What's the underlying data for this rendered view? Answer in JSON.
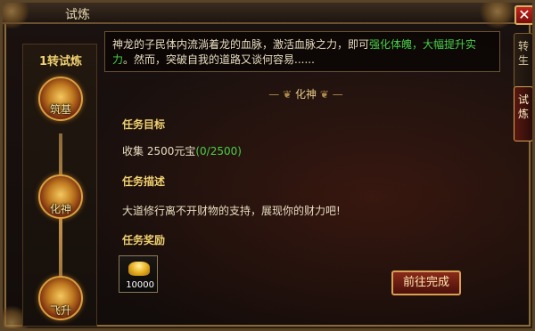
{
  "window": {
    "title": "试炼",
    "close_label": "✕"
  },
  "left_panel": {
    "trial_level": "1转试炼",
    "stages": [
      "筑基",
      "化神",
      "飞升"
    ]
  },
  "tabs": [
    {
      "label": "转\n生",
      "active": false
    },
    {
      "label": "试\n炼",
      "active": true
    }
  ],
  "description": {
    "part1": "神龙的子民体内流淌着龙的血脉，激活血脉之力，即可",
    "highlight": "强化体魄，大幅提升实力",
    "part2": "。然而，突破自我的道路又谈何容易......"
  },
  "section": {
    "name": "化神"
  },
  "task": {
    "objective_title": "任务目标",
    "objective_text": "收集  2500元宝",
    "progress": "(0/2500)",
    "desc_title": "任务描述",
    "desc_text": "大道修行离不开财物的支持，展现你的财力吧!",
    "reward_title": "任务奖励",
    "reward_count": "10000"
  },
  "button": {
    "go_label": "前往完成"
  },
  "colors": {
    "accent_gold": "#f0d070",
    "highlight_green": "#48d048",
    "button_red": "#8a2a1a"
  }
}
